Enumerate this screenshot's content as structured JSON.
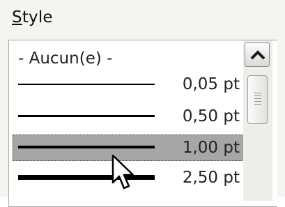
{
  "style_group": {
    "label_accel": "S",
    "label_rest": "tyle"
  },
  "list": {
    "items": [
      {
        "label": "- Aucun(e) -",
        "selected": false
      },
      {
        "label": "0,05 pt",
        "selected": false
      },
      {
        "label": "0,50 pt",
        "selected": false
      },
      {
        "label": "1,00 pt",
        "selected": true
      },
      {
        "label": "2,50 pt",
        "selected": false
      }
    ]
  },
  "colors": {
    "selection": "#a6a6a6",
    "line": "#000000"
  },
  "icons": {
    "scroll_up": "chevron-up-icon",
    "thumb_grip": "grip-icon",
    "cursor": "mouse-pointer-icon"
  }
}
